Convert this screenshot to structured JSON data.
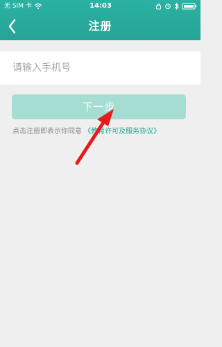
{
  "status_bar": {
    "carrier": "无 SIM 卡",
    "time": "14:03",
    "icons": [
      "wifi-icon",
      "lock-icon",
      "alarm-icon",
      "bluetooth-icon",
      "battery-icon"
    ]
  },
  "nav": {
    "title": "注册",
    "back_icon": "back-chevron-icon"
  },
  "form": {
    "phone_placeholder": "请输入手机号",
    "next_label": "下一步"
  },
  "agreement": {
    "prefix": "点击注册即表示你同意",
    "link": "《教育许可及服务协议》"
  },
  "colors": {
    "header": "#2ab2a2",
    "button_disabled": "#a5ddd3",
    "link": "#21a897",
    "annotation_arrow": "#e31d1d"
  }
}
